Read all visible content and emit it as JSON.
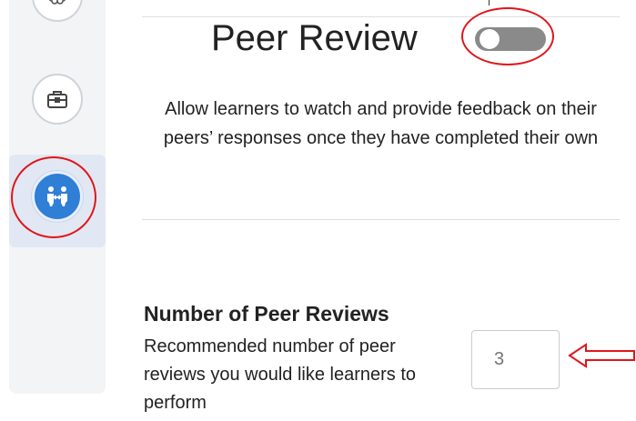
{
  "sidebar": {
    "items": [
      {
        "icon": "brain-icon",
        "active": false
      },
      {
        "icon": "briefcase-icon",
        "active": false
      },
      {
        "icon": "peer-exchange-icon",
        "active": true
      }
    ],
    "accent_color": "#2f7fd6"
  },
  "peer_review": {
    "title": "Peer Review",
    "toggle_on": false,
    "description": "Allow learners to watch and provide feedback on their peers’ responses once they have completed their own"
  },
  "peer_count": {
    "heading": "Number of Peer Reviews",
    "description": "Recommended number of peer reviews you would like learners to perform",
    "placeholder": "3"
  },
  "annotations": {
    "color": "#e0161b"
  }
}
